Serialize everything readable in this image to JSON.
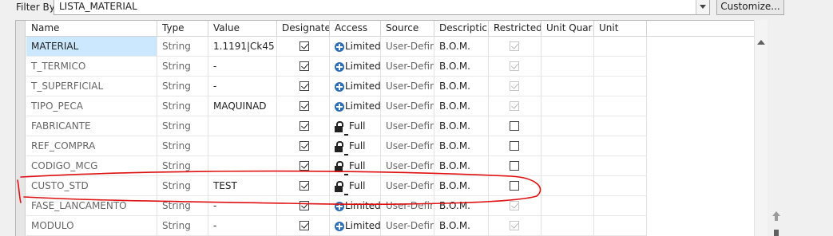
{
  "filter": {
    "label": "Filter By",
    "value": "LISTA_MATERIAL",
    "customize_label": "Customize..."
  },
  "columns": [
    "Name",
    "Type",
    "Value",
    "Designate",
    "Access",
    "Source",
    "Descriptic",
    "Restricted",
    "Unit Quar",
    "Unit"
  ],
  "rows": [
    {
      "name": "MATERIAL",
      "type": "String",
      "value": "1.1191|Ck45",
      "designate": true,
      "access": "Limited",
      "access_icon": "plus-circle-icon",
      "source": "User-Define",
      "description": "B.O.M.",
      "restricted": true,
      "restricted_enabled": false
    },
    {
      "name": "T_TERMICO",
      "type": "String",
      "value": "-",
      "designate": true,
      "access": "Limited",
      "access_icon": "plus-circle-icon",
      "source": "User-Define",
      "description": "B.O.M.",
      "restricted": true,
      "restricted_enabled": false
    },
    {
      "name": "T_SUPERFICIAL",
      "type": "String",
      "value": "-",
      "designate": true,
      "access": "Limited",
      "access_icon": "plus-circle-icon",
      "source": "User-Define",
      "description": "B.O.M.",
      "restricted": true,
      "restricted_enabled": false
    },
    {
      "name": "TIPO_PECA",
      "type": "String",
      "value": "MAQUINAD",
      "designate": true,
      "access": "Limited",
      "access_icon": "plus-circle-icon",
      "source": "User-Define",
      "description": "B.O.M.",
      "restricted": true,
      "restricted_enabled": false
    },
    {
      "name": "FABRICANTE",
      "type": "String",
      "value": "",
      "designate": true,
      "access": "Full",
      "access_icon": "lock-icon",
      "source": "User-Define",
      "description": "B.O.M.",
      "restricted": false,
      "restricted_enabled": true
    },
    {
      "name": "REF_COMPRA",
      "type": "String",
      "value": "",
      "designate": true,
      "access": "Full",
      "access_icon": "lock-icon",
      "source": "User-Define",
      "description": "B.O.M.",
      "restricted": false,
      "restricted_enabled": true
    },
    {
      "name": "CODIGO_MCG",
      "type": "String",
      "value": "",
      "designate": true,
      "access": "Full",
      "access_icon": "lock-icon",
      "source": "User-Define",
      "description": "B.O.M.",
      "restricted": false,
      "restricted_enabled": true
    },
    {
      "name": "CUSTO_STD",
      "type": "String",
      "value": "TEST",
      "designate": true,
      "access": "Full",
      "access_icon": "lock-icon",
      "source": "User-Define",
      "description": "B.O.M.",
      "restricted": false,
      "restricted_enabled": true
    },
    {
      "name": "FASE_LANCAMENTO",
      "type": "String",
      "value": "-",
      "designate": true,
      "access": "Limited",
      "access_icon": "plus-circle-icon",
      "source": "User-Define",
      "description": "B.O.M.",
      "restricted": true,
      "restricted_enabled": false
    },
    {
      "name": "MODULO",
      "type": "String",
      "value": "-",
      "designate": true,
      "access": "Limited",
      "access_icon": "plus-circle-icon",
      "source": "User-Define",
      "description": "B.O.M.",
      "restricted": true,
      "restricted_enabled": false
    }
  ],
  "selected_row": 0,
  "annotation_color": "#e01010"
}
